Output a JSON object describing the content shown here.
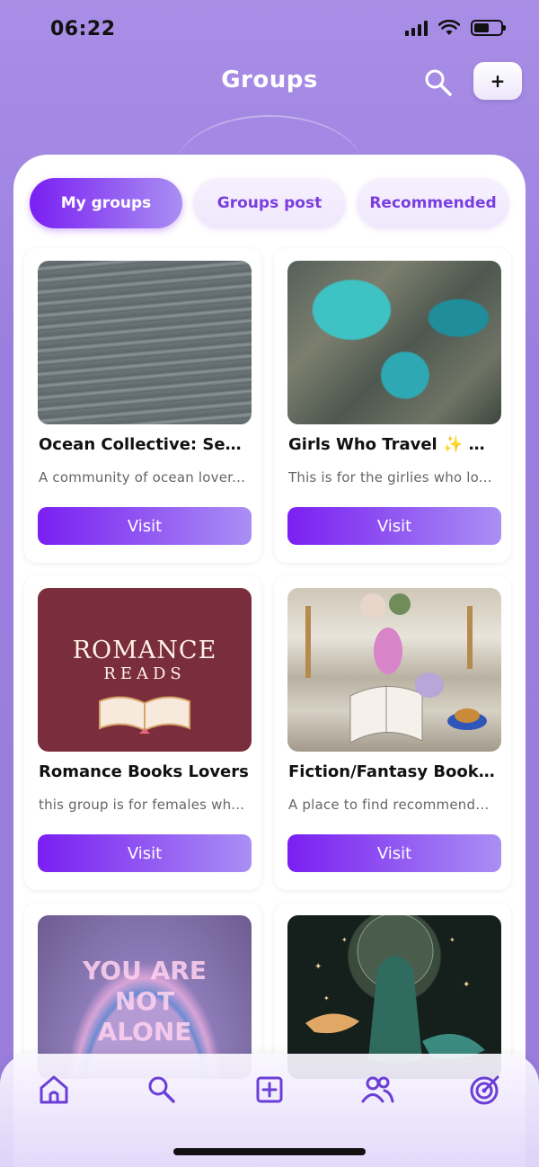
{
  "status_bar": {
    "time": "06:22"
  },
  "header": {
    "title": "Groups",
    "add_label": "+"
  },
  "tabs": [
    {
      "label": "My groups",
      "active": true
    },
    {
      "label": "Groups post",
      "active": false
    },
    {
      "label": "Recommended",
      "active": false
    }
  ],
  "groups": [
    {
      "title": "Ocean Collective: Sea S...",
      "description": "A community of ocean lover...",
      "button": "Visit"
    },
    {
      "title": "Girls Who Travel ✨ 🌎 ...",
      "description": "This is for the girlies who lo...",
      "button": "Visit"
    },
    {
      "title": "Romance Books Lovers",
      "description": "this group is for females wh...",
      "button": "Visit"
    },
    {
      "title": "Fiction/Fantasy Bookw...",
      "description": "A place to find recommenda...",
      "button": "Visit"
    },
    {
      "title": "",
      "description": "",
      "button": ""
    },
    {
      "title": "",
      "description": "",
      "button": ""
    }
  ],
  "thumb_text": {
    "romance_line1": "ROMANCE",
    "romance_line2": "READS",
    "alone": "YOU ARE NOT ALONE"
  },
  "colors": {
    "accent": "#7a1ff2",
    "accent_light": "#a98ff3",
    "background": "#9b7fe0",
    "nav_icon": "#6b3fd6"
  },
  "bottom_nav": [
    "home-icon",
    "search-icon",
    "add-post-icon",
    "groups-icon",
    "goals-icon"
  ]
}
